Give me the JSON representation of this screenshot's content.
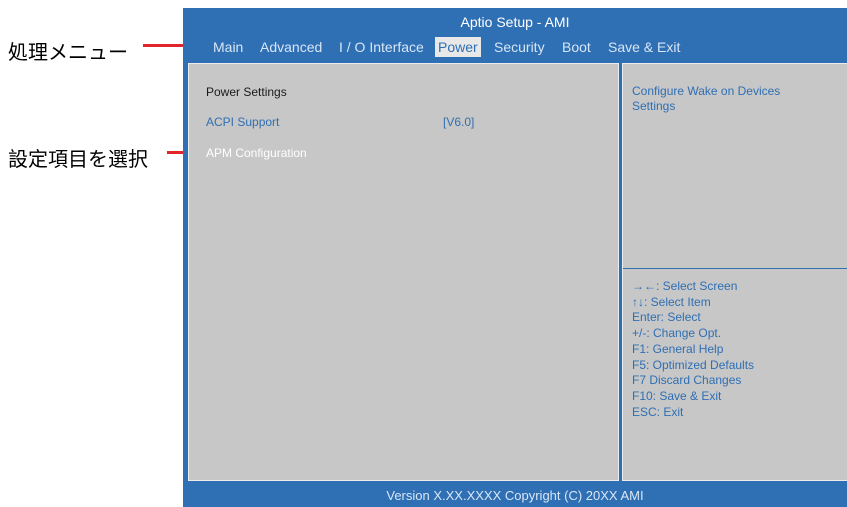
{
  "annotations": {
    "menu_label": "処理メニュー",
    "select_label": "設定項目を選択"
  },
  "window": {
    "title": "Aptio Setup - AMI"
  },
  "menu": [
    {
      "label": "Main"
    },
    {
      "label": "Advanced"
    },
    {
      "label": "I / O Interface"
    },
    {
      "label": "Power"
    },
    {
      "label": "Security"
    },
    {
      "label": "Boot"
    },
    {
      "label": "Save & Exit"
    }
  ],
  "active_menu": "Power",
  "settings": {
    "section_title": "Power Settings",
    "acpi_label": "ACPI Support",
    "acpi_value": "[V6.0]",
    "apm_label": "APM Configuration"
  },
  "help": {
    "description": "Configure Wake on Devices Settings",
    "keys": [
      "→←: Select Screen",
      "↑↓: Select Item",
      "Enter: Select",
      "+/-: Change Opt.",
      "F1: General Help",
      "F5: Optimized Defaults",
      "F7 Discard Changes",
      "F10: Save & Exit",
      "ESC: Exit"
    ]
  },
  "footer": {
    "version": "Version X.XX.XXXX Copyright (C) 20XX AMI"
  },
  "colors": {
    "bios_blue": "#2f6fb3",
    "panel_gray": "#c7c7c7",
    "annotation_red": "#e0262a"
  }
}
